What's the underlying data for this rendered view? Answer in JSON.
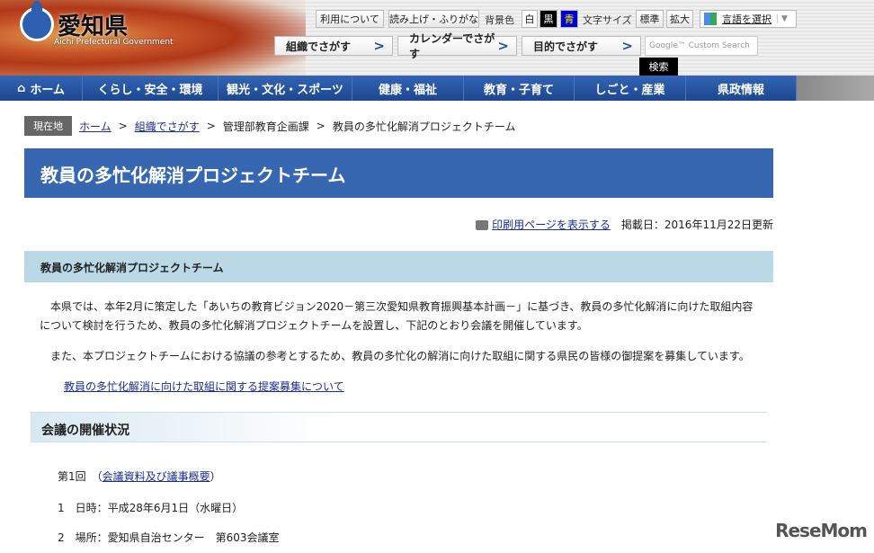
{
  "header": {
    "logo_jp": "愛知県",
    "logo_en": "Aichi Prefectural Government",
    "util": {
      "usage": "利用について",
      "readout": "読み上げ・ふりがな",
      "bg_label": "背景色",
      "bg_white": "白",
      "bg_black": "黒",
      "bg_blue": "青",
      "size_label": "文字サイズ",
      "size_std": "標準",
      "size_big": "拡大",
      "lang": "言語を選択"
    },
    "search_buttons": [
      "組織でさがす",
      "カレンダーでさがす",
      "目的でさがす"
    ],
    "search_placeholder": "Google™ Custom Search",
    "search_button": "検索"
  },
  "nav": [
    "ホーム",
    "くらし・安全・環境",
    "観光・文化・スポーツ",
    "健康・福祉",
    "教育・子育て",
    "しごと・産業",
    "県政情報"
  ],
  "breadcrumb": {
    "label": "現在地",
    "items": [
      "ホーム",
      "組織でさがす",
      "管理部教育企画課",
      "教員の多忙化解消プロジェクトチーム"
    ],
    "sep": ">"
  },
  "page_title": "教員の多忙化解消プロジェクトチーム",
  "print_link": "印刷用ページを表示する",
  "updated": "掲載日：2016年11月22日更新",
  "section_heading": "教員の多忙化解消プロジェクトチーム",
  "paragraphs": [
    "本県では、本年2月に策定した「あいちの教育ビジョン2020－第三次愛知県教育振興基本計画－」に基づき、教員の多忙化解消に向けた取組内容について検討を行うため、教員の多忙化解消プロジェクトチームを設置し、下記のとおり会議を開催しています。",
    "また、本プロジェクトチームにおける協議の参考とするため、教員の多忙化の解消に向けた取組に関する県民の皆様の御提案を募集しています。"
  ],
  "proposal_link": "教員の多忙化解消に向けた取組に関する提案募集について",
  "meetings": {
    "heading": "会議の開催状況",
    "round": "第1回",
    "materials_link": "会議資料及び議事概要",
    "date": "1　日時：平成28年6月1日（水曜日）",
    "place": "2　場所：愛知県自治センター　第603会議室"
  },
  "watermark": "ReseMom",
  "colors": {
    "nav": "#1f4e9c",
    "title": "#3767b0",
    "section": "#b9d9e6"
  }
}
